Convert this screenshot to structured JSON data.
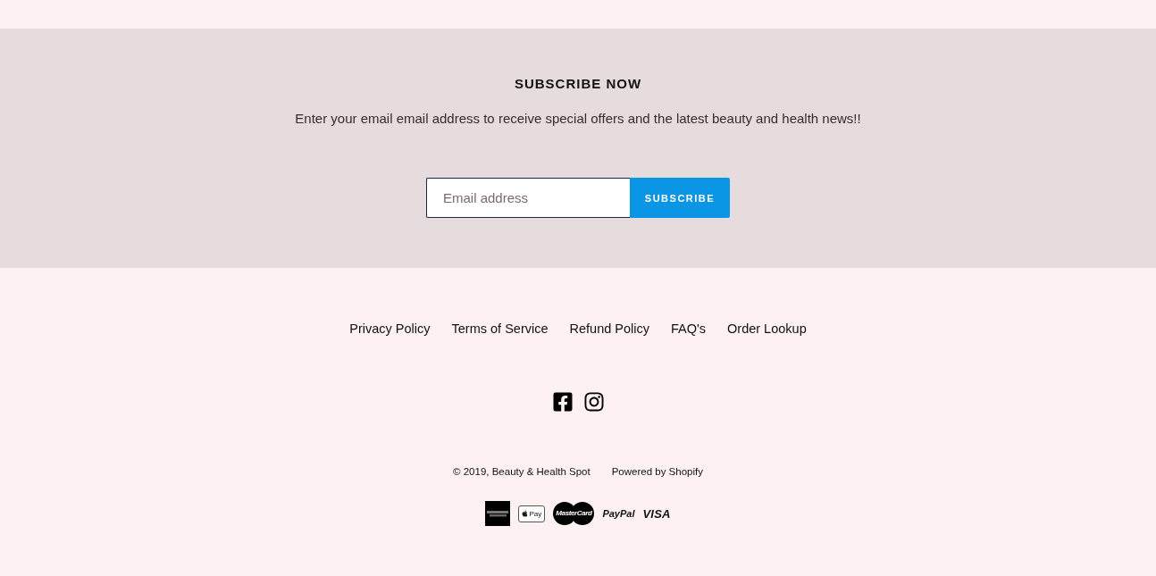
{
  "newsletter": {
    "title": "SUBSCRIBE NOW",
    "description": "Enter your email email address to receive special offers and the latest beauty and health news!!",
    "email_field": {
      "placeholder": "Email address"
    },
    "submit_button": "SUBSCRIBE"
  },
  "footer_links": [
    "Privacy Policy",
    "Terms of Service",
    "Refund Policy",
    "FAQ's",
    "Order Lookup"
  ],
  "social_links": [
    {
      "kind": "facebook"
    },
    {
      "kind": "instagram"
    }
  ],
  "copyright": {
    "prefix": "© 2019,",
    "store_name": "Beauty & Health Spot"
  },
  "powered_by": "Powered by Shopify",
  "payment_icons": [
    {
      "kind": "amex"
    },
    {
      "kind": "apple_pay",
      "label": "Pay"
    },
    {
      "kind": "mastercard",
      "label": "MasterCard"
    },
    {
      "kind": "paypal",
      "label": "PayPal"
    },
    {
      "kind": "visa",
      "label": "VISA"
    }
  ]
}
